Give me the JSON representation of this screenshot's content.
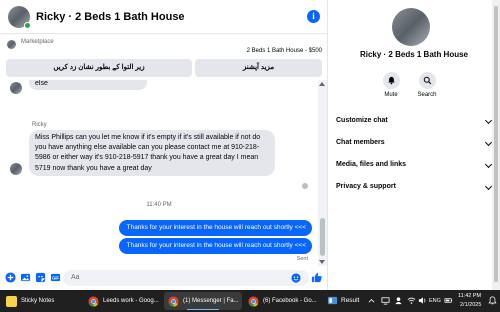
{
  "header": {
    "title": "Ricky · 2 Beds 1 Bath House"
  },
  "marketplace": {
    "label": "Marketplace",
    "listing": "2 Beds 1 Bath House - $500",
    "btn_left": "زیر التوا کے بطور نشان زد کریں",
    "btn_right": "مزید آپشنز"
  },
  "messages": {
    "partial_text": "else",
    "sender": "Ricky",
    "long_message": "Miss Phillips can you let me know if it's empty if it's still available if not do you have anything else available can you please contact me at 910-218-5986 or either way it's 910-218-5917 thank you have a great day I mean 5719 now thank you have a great day",
    "time_divider": "11:40 PM",
    "outgoing": [
      "Thanks for your interest in the house will reach out shortly   <<<",
      "Thanks for your interest in the house will reach out shortly   <<<"
    ],
    "status": "Sent"
  },
  "composer": {
    "placeholder": "Aa"
  },
  "side": {
    "name": "Ricky · 2 Beds 1 Bath House",
    "mute_label": "Mute",
    "search_label": "Search",
    "sections": [
      "Customize chat",
      "Chat members",
      "Media, files and links",
      "Privacy & support"
    ]
  },
  "taskbar": {
    "apps": [
      "Sticky Notes",
      "Leeds work - Goog...",
      "(1) Messenger | Fa...",
      "(6) Facebook - Go..."
    ],
    "search": "Result",
    "lang": "ENG",
    "time": "11:42 PM",
    "date": "2/1/2025"
  },
  "colors": {
    "accent": "#0866ff",
    "bubble_in": "#e4e6eb",
    "taskbar": "#202020"
  }
}
